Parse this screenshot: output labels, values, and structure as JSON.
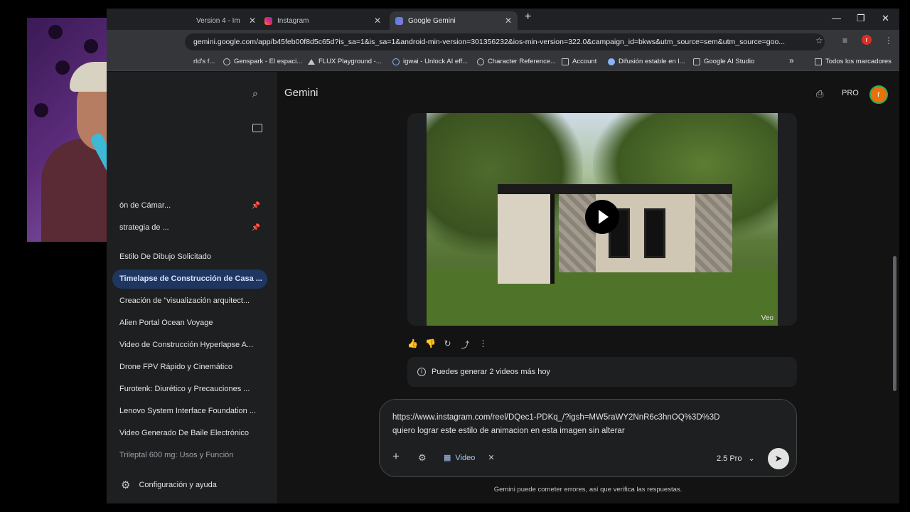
{
  "browser": {
    "tabs": [
      {
        "title": "Version 4 - Im"
      },
      {
        "title": "Instagram"
      },
      {
        "title": "Google Gemini"
      }
    ],
    "new_tab": "+",
    "url": "gemini.google.com/app/b45feb00f8d5c65d?is_sa=1&is_sa=1&android-min-version=301356232&ios-min-version=322.0&campaign_id=bkws&utm_source=sem&utm_source=goo...",
    "profile_initial": "r",
    "bookmarks": [
      "rld's f...",
      "Genspark - El espaci...",
      "FLUX Playground -...",
      "igwai - Unlock AI eff...",
      "Character Reference...",
      "Account",
      "Difusión estable en l...",
      "Google AI Studio"
    ],
    "bookmarks_overflow": "»",
    "all_bookmarks": "Todos los marcadores"
  },
  "sidebar": {
    "items": [
      {
        "label": "ón de Cámar..."
      },
      {
        "label": "strategia de ..."
      },
      {
        "label": "Estilo De Dibujo Solicitado"
      },
      {
        "label": "Timelapse de Construcción de Casa ..."
      },
      {
        "label": "Creación de \"visualización arquitect..."
      },
      {
        "label": "Alien Portal Ocean Voyage"
      },
      {
        "label": "Video de Construcción Hyperlapse A..."
      },
      {
        "label": "Drone FPV Rápido y Cinemático"
      },
      {
        "label": "Furotenk: Diurético y Precauciones ..."
      },
      {
        "label": "Lenovo System Interface Foundation ..."
      },
      {
        "label": "Video Generado De Baile Electrónico"
      },
      {
        "label": "Trileptal 600 mg: Usos y Función"
      }
    ],
    "settings": "Configuración y ayuda"
  },
  "header": {
    "title": "Gemini",
    "pro_badge": "PRO",
    "avatar_initial": "r"
  },
  "video": {
    "watermark": "Veo"
  },
  "notice": {
    "text": "Puedes generar 2 videos más hoy"
  },
  "composer": {
    "prompt": "https://www.instagram.com/reel/DQec1-PDKq_/?igsh=MW5raWY2NnR6c3hnOQ%3D%3D\nquiero lograr este estilo de animacion en esta imagen sin alterar",
    "tool_chip": "Video",
    "model": "2.5 Pro"
  },
  "disclaimer": "Gemini puede cometer errores, así que verifica las respuestas.",
  "colors": {
    "background": "#131314",
    "sidebar": "#1e1f20",
    "active_item": "#1f3760",
    "accent": "#a8c7fa"
  }
}
